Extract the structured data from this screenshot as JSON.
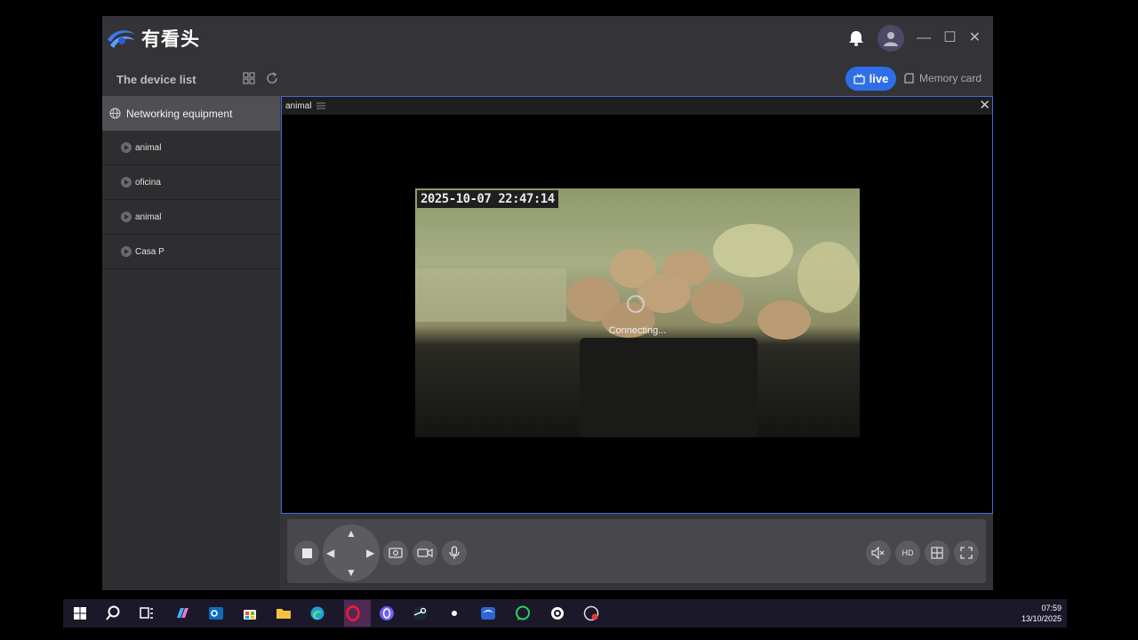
{
  "app": {
    "title": "有看头"
  },
  "subbar": {
    "device_list_title": "The device list",
    "live_label": "live",
    "memory_label": "Memory card"
  },
  "sidebar": {
    "group_label": "Networking equipment",
    "items": [
      {
        "label": "animal"
      },
      {
        "label": "oficina"
      },
      {
        "label": "animal"
      },
      {
        "label": "Casa P"
      }
    ]
  },
  "video": {
    "pane_title": "animal",
    "timestamp": "2025-10-07 22:47:14",
    "status_text": "Connecting..."
  },
  "controls": {
    "hd_label": "HD"
  },
  "taskbar": {
    "time": "07:59",
    "date": "13/10/2025"
  },
  "colors": {
    "accent": "#2e6fe8",
    "app_bg": "#343438",
    "sidebar_bg": "#2e2e31",
    "pane_border": "#3d6fd6"
  }
}
